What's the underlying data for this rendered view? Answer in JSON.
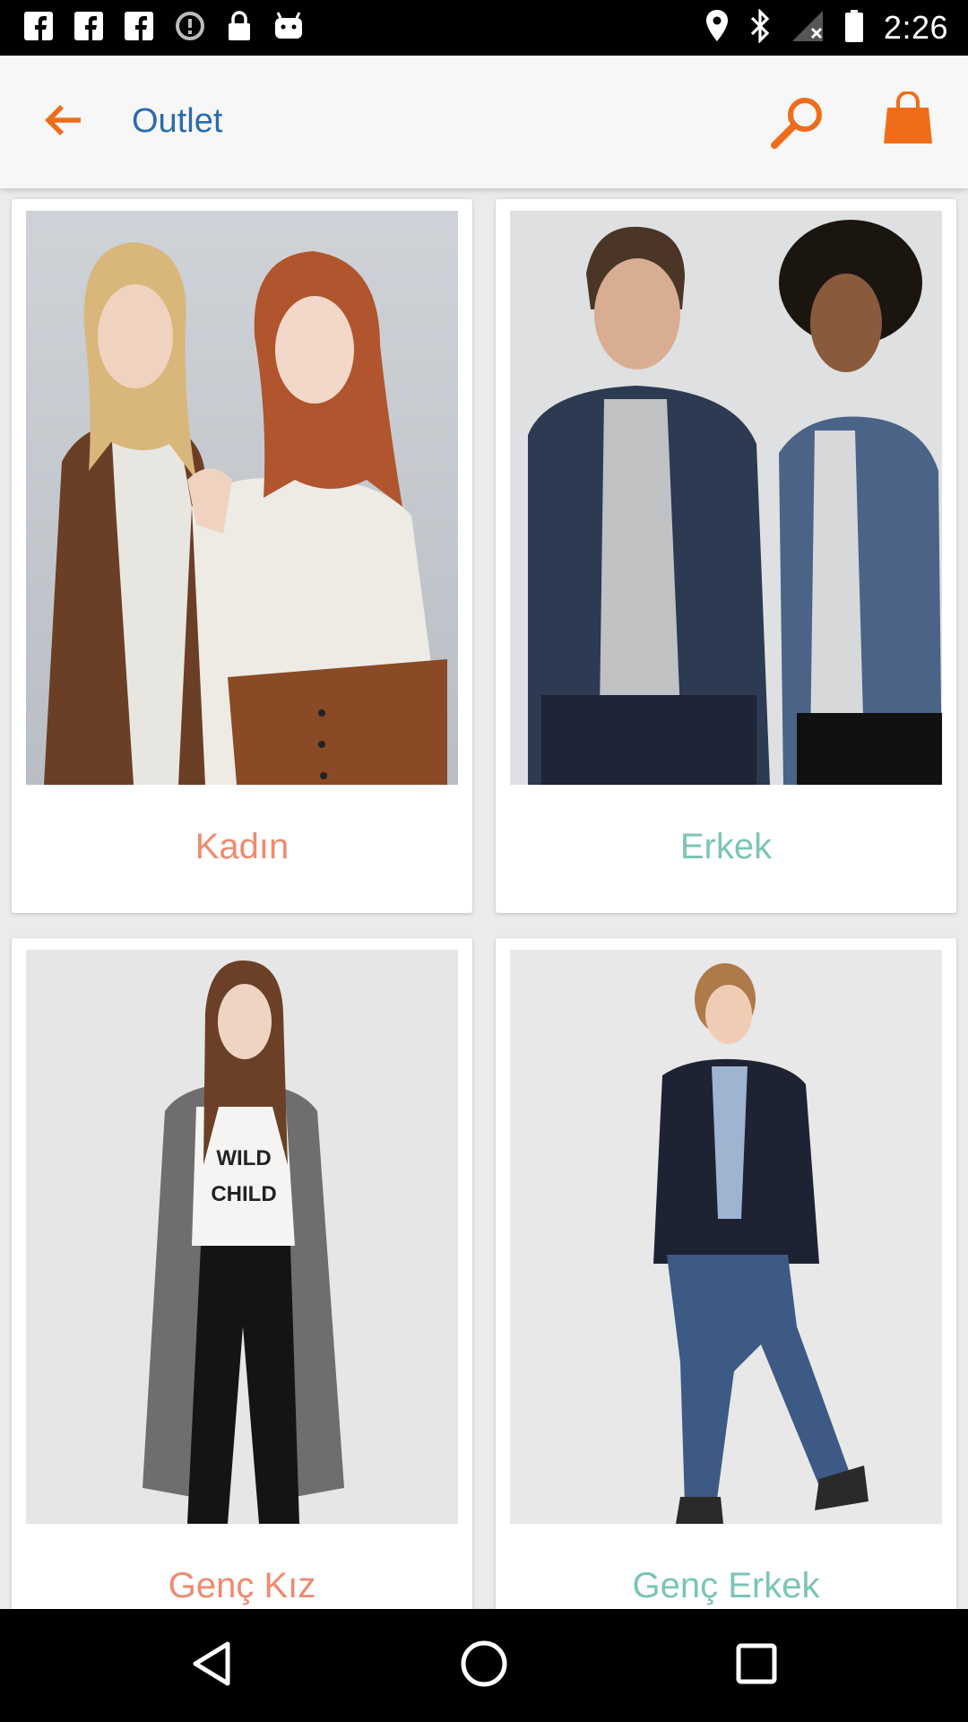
{
  "status_bar": {
    "time": "2:26",
    "left_icons": [
      "facebook-icon",
      "facebook-icon",
      "facebook-icon",
      "data-saver-icon",
      "lock-icon",
      "android-robot-icon"
    ],
    "right_icons": [
      "location-icon",
      "bluetooth-icon",
      "signal-off-icon",
      "battery-icon"
    ]
  },
  "app_bar": {
    "title": "Outlet",
    "back_icon": "arrow-left-icon",
    "search_icon": "search-icon",
    "cart_icon": "shopping-bag-icon",
    "accent_color": "#f06c1a",
    "title_color": "#2a6cb0"
  },
  "categories": [
    {
      "label": "Kadın",
      "color": "#f08a6e"
    },
    {
      "label": "Erkek",
      "color": "#7bc5b5"
    },
    {
      "label": "Genç Kız",
      "color": "#f08a6e"
    },
    {
      "label": "Genç Erkek",
      "color": "#7bc5b5"
    }
  ],
  "nav_bar": {
    "icons": [
      "back-triangle-icon",
      "home-circle-icon",
      "recents-square-icon"
    ]
  }
}
